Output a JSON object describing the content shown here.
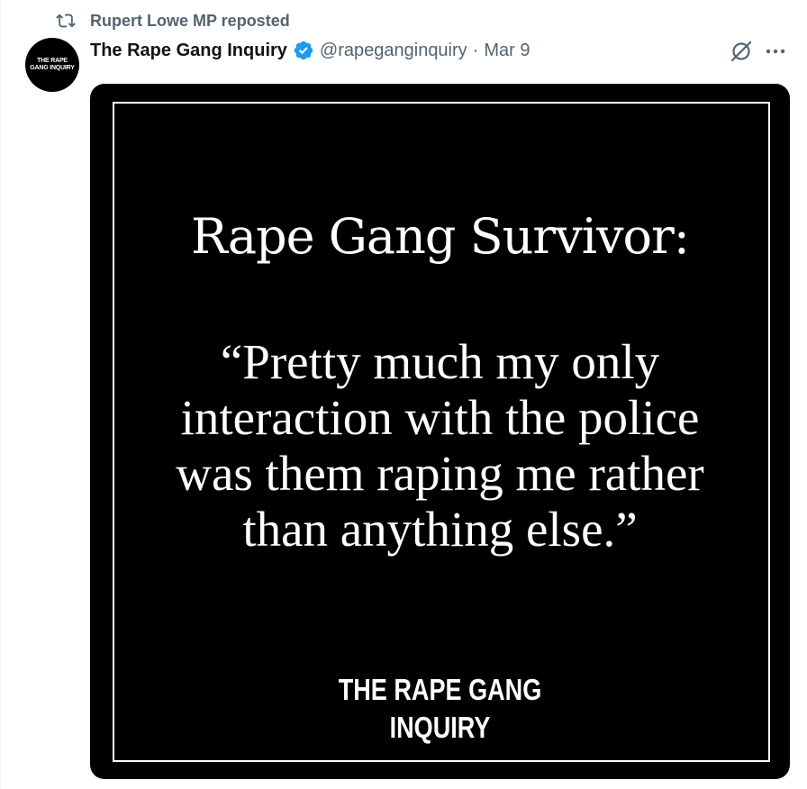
{
  "repost": {
    "label": "Rupert Lowe MP reposted",
    "icon": "repost-icon"
  },
  "post": {
    "avatar_text": "THE RAPE GANG INQUIRY",
    "display_name": "The Rape Gang Inquiry",
    "verified_icon": "verified-badge-icon",
    "handle": "@rapeganginquiry",
    "separator": "·",
    "date": "Mar 9",
    "grok_icon": "grok-icon",
    "more_icon": "more-icon"
  },
  "media": {
    "title": "Rape Gang Survivor:",
    "quote": "“Pretty much my only interaction with the police was them raping me rather than anything else.”",
    "brand_line1": "THE RAPE GANG",
    "brand_line2": "INQUIRY"
  },
  "colors": {
    "text_primary": "#0f1419",
    "text_secondary": "#536471",
    "verified_blue": "#1d9bf0",
    "media_background": "#000000"
  }
}
